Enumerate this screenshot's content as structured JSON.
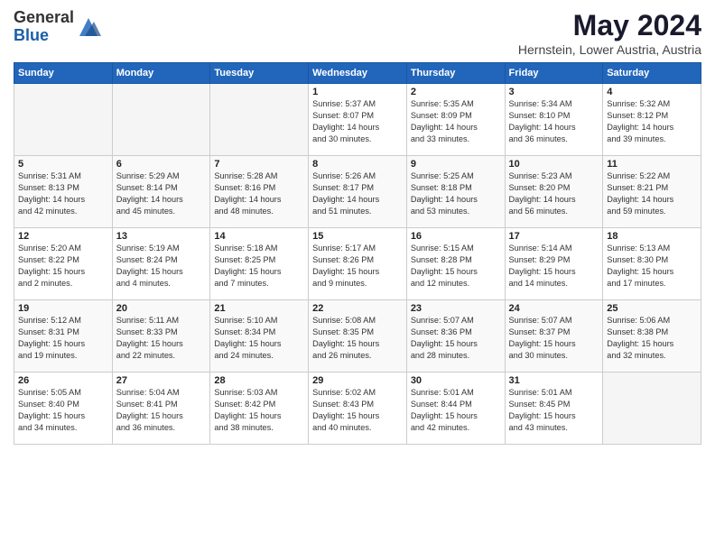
{
  "logo": {
    "general": "General",
    "blue": "Blue"
  },
  "title": "May 2024",
  "location": "Hernstein, Lower Austria, Austria",
  "weekdays": [
    "Sunday",
    "Monday",
    "Tuesday",
    "Wednesday",
    "Thursday",
    "Friday",
    "Saturday"
  ],
  "weeks": [
    [
      {
        "day": "",
        "info": ""
      },
      {
        "day": "",
        "info": ""
      },
      {
        "day": "",
        "info": ""
      },
      {
        "day": "1",
        "info": "Sunrise: 5:37 AM\nSunset: 8:07 PM\nDaylight: 14 hours\nand 30 minutes."
      },
      {
        "day": "2",
        "info": "Sunrise: 5:35 AM\nSunset: 8:09 PM\nDaylight: 14 hours\nand 33 minutes."
      },
      {
        "day": "3",
        "info": "Sunrise: 5:34 AM\nSunset: 8:10 PM\nDaylight: 14 hours\nand 36 minutes."
      },
      {
        "day": "4",
        "info": "Sunrise: 5:32 AM\nSunset: 8:12 PM\nDaylight: 14 hours\nand 39 minutes."
      }
    ],
    [
      {
        "day": "5",
        "info": "Sunrise: 5:31 AM\nSunset: 8:13 PM\nDaylight: 14 hours\nand 42 minutes."
      },
      {
        "day": "6",
        "info": "Sunrise: 5:29 AM\nSunset: 8:14 PM\nDaylight: 14 hours\nand 45 minutes."
      },
      {
        "day": "7",
        "info": "Sunrise: 5:28 AM\nSunset: 8:16 PM\nDaylight: 14 hours\nand 48 minutes."
      },
      {
        "day": "8",
        "info": "Sunrise: 5:26 AM\nSunset: 8:17 PM\nDaylight: 14 hours\nand 51 minutes."
      },
      {
        "day": "9",
        "info": "Sunrise: 5:25 AM\nSunset: 8:18 PM\nDaylight: 14 hours\nand 53 minutes."
      },
      {
        "day": "10",
        "info": "Sunrise: 5:23 AM\nSunset: 8:20 PM\nDaylight: 14 hours\nand 56 minutes."
      },
      {
        "day": "11",
        "info": "Sunrise: 5:22 AM\nSunset: 8:21 PM\nDaylight: 14 hours\nand 59 minutes."
      }
    ],
    [
      {
        "day": "12",
        "info": "Sunrise: 5:20 AM\nSunset: 8:22 PM\nDaylight: 15 hours\nand 2 minutes."
      },
      {
        "day": "13",
        "info": "Sunrise: 5:19 AM\nSunset: 8:24 PM\nDaylight: 15 hours\nand 4 minutes."
      },
      {
        "day": "14",
        "info": "Sunrise: 5:18 AM\nSunset: 8:25 PM\nDaylight: 15 hours\nand 7 minutes."
      },
      {
        "day": "15",
        "info": "Sunrise: 5:17 AM\nSunset: 8:26 PM\nDaylight: 15 hours\nand 9 minutes."
      },
      {
        "day": "16",
        "info": "Sunrise: 5:15 AM\nSunset: 8:28 PM\nDaylight: 15 hours\nand 12 minutes."
      },
      {
        "day": "17",
        "info": "Sunrise: 5:14 AM\nSunset: 8:29 PM\nDaylight: 15 hours\nand 14 minutes."
      },
      {
        "day": "18",
        "info": "Sunrise: 5:13 AM\nSunset: 8:30 PM\nDaylight: 15 hours\nand 17 minutes."
      }
    ],
    [
      {
        "day": "19",
        "info": "Sunrise: 5:12 AM\nSunset: 8:31 PM\nDaylight: 15 hours\nand 19 minutes."
      },
      {
        "day": "20",
        "info": "Sunrise: 5:11 AM\nSunset: 8:33 PM\nDaylight: 15 hours\nand 22 minutes."
      },
      {
        "day": "21",
        "info": "Sunrise: 5:10 AM\nSunset: 8:34 PM\nDaylight: 15 hours\nand 24 minutes."
      },
      {
        "day": "22",
        "info": "Sunrise: 5:08 AM\nSunset: 8:35 PM\nDaylight: 15 hours\nand 26 minutes."
      },
      {
        "day": "23",
        "info": "Sunrise: 5:07 AM\nSunset: 8:36 PM\nDaylight: 15 hours\nand 28 minutes."
      },
      {
        "day": "24",
        "info": "Sunrise: 5:07 AM\nSunset: 8:37 PM\nDaylight: 15 hours\nand 30 minutes."
      },
      {
        "day": "25",
        "info": "Sunrise: 5:06 AM\nSunset: 8:38 PM\nDaylight: 15 hours\nand 32 minutes."
      }
    ],
    [
      {
        "day": "26",
        "info": "Sunrise: 5:05 AM\nSunset: 8:40 PM\nDaylight: 15 hours\nand 34 minutes."
      },
      {
        "day": "27",
        "info": "Sunrise: 5:04 AM\nSunset: 8:41 PM\nDaylight: 15 hours\nand 36 minutes."
      },
      {
        "day": "28",
        "info": "Sunrise: 5:03 AM\nSunset: 8:42 PM\nDaylight: 15 hours\nand 38 minutes."
      },
      {
        "day": "29",
        "info": "Sunrise: 5:02 AM\nSunset: 8:43 PM\nDaylight: 15 hours\nand 40 minutes."
      },
      {
        "day": "30",
        "info": "Sunrise: 5:01 AM\nSunset: 8:44 PM\nDaylight: 15 hours\nand 42 minutes."
      },
      {
        "day": "31",
        "info": "Sunrise: 5:01 AM\nSunset: 8:45 PM\nDaylight: 15 hours\nand 43 minutes."
      },
      {
        "day": "",
        "info": ""
      }
    ]
  ]
}
